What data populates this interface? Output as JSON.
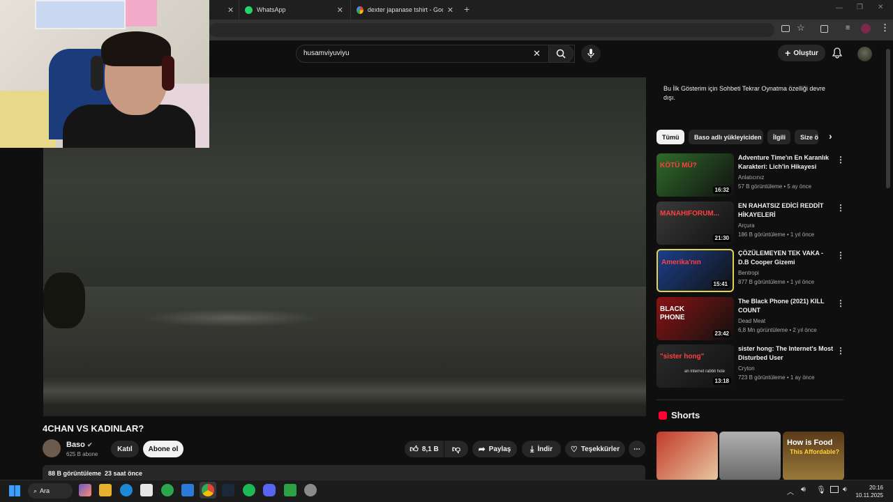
{
  "browser": {
    "tabs": [
      {
        "label": "WhatsApp"
      },
      {
        "label": "dexter japanase tshirt - Google"
      }
    ]
  },
  "header": {
    "search_value": "husamviyuviyu",
    "create_label": "Oluştur"
  },
  "video": {
    "title": "4CHAN VS KADINLAR?",
    "channel": "Baso",
    "subscribers": "625 B abone",
    "join_label": "Katıl",
    "subscribe_label": "Abone ol",
    "likes": "8,1 B",
    "share_label": "Paylaş",
    "download_label": "İndir",
    "thanks_label": "Teşekkürler",
    "views": "88 B görüntüleme",
    "age": "23 saat önce"
  },
  "sidebar": {
    "chat_notice": "Bu İlk Gösterim için Sohbeti Tekrar Oynatma özelliği devre dışı.",
    "chips": [
      "Tümü",
      "Baso adlı yükleyiciden",
      "İlgili",
      "Size ö"
    ],
    "recommendations": [
      {
        "title": "Adventure Time'ın En Karanlık Karakteri: Lich'in Hikayesi",
        "channel": "Anlatıcınız",
        "meta": "57 B görüntüleme • 5 ay önce",
        "duration": "16:32",
        "thumb_text": "KÖTÜ MÜ?",
        "thumb_color": "#2f6b2a"
      },
      {
        "title": "EN RAHATSIZ EDİCİ REDDİT HİKAYELERİ",
        "channel": "Arçura",
        "meta": "186 B görüntüleme • 1 yıl önce",
        "duration": "21:30",
        "thumb_text": "MANAHIFORUM...",
        "thumb_color": "#3a3a3a"
      },
      {
        "title": "ÇÖZÜLEMEYEN TEK VAKA - D.B Cooper Gizemi",
        "channel": "Bentropi",
        "meta": "877 B görüntüleme • 1 yıl önce",
        "duration": "15:41",
        "thumb_text": "Amerika'nın",
        "thumb_color": "#1b3f8a"
      },
      {
        "title": "The Black Phone (2021) KILL COUNT",
        "channel": "Dead Meat",
        "meta": "6,8 Mn görüntüleme • 2 yıl önce",
        "duration": "23:42",
        "thumb_text": "BLACK PHONE",
        "thumb_color": "#8a1212"
      },
      {
        "title": "sister hong: The Internet's Most Disturbed User",
        "channel": "Cryton",
        "meta": "723 B görüntüleme • 1 ay önce",
        "duration": "13:18",
        "thumb_text": "\"sister hong\"",
        "thumb_sub": "an internet rabbit hole",
        "thumb_color": "#2b2b2b"
      }
    ],
    "shorts_title": "Shorts",
    "shorts": [
      {
        "color": "#d9443a"
      },
      {
        "color": "#9a9a9a",
        "text": ""
      },
      {
        "text": "How is Food",
        "sub": "This Affordable?",
        "color": "#7a5a2a"
      }
    ]
  },
  "taskbar": {
    "search_label": "Ara",
    "time": "20:16",
    "date": "10.11.2025"
  }
}
